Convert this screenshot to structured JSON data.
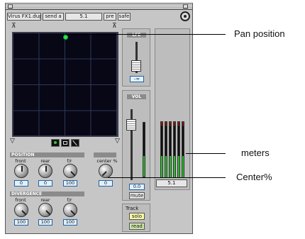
{
  "toolbar": {
    "insert": "Virus FX1.dup1",
    "send": "send a",
    "output": "5.1",
    "pre": "pre",
    "safe": "safe"
  },
  "position": {
    "header": "POSITION",
    "front_label": "front",
    "rear_label": "rear",
    "fr_label": "f/r",
    "center_label": "center %",
    "front_value": "0",
    "rear_value": "0",
    "fr_value": "100",
    "center_value": "0"
  },
  "divergence": {
    "header": "DIVERGENCE",
    "front_label": "front",
    "rear_label": "rear",
    "fr_label": "f/r",
    "front_value": "100",
    "rear_value": "100",
    "fr_value": "100"
  },
  "lfe": {
    "header": "LFE",
    "value": "-∞"
  },
  "vol": {
    "header": "VOL",
    "value": "0.0",
    "mute_label": "mute"
  },
  "meter_section": {
    "output_label": "5.1"
  },
  "track": {
    "label": "Track",
    "solo_label": "solo",
    "read_label": "read"
  },
  "callouts": {
    "pan": "Pan position",
    "meters": "meters",
    "center": "Center%"
  },
  "colors": {
    "grid_bg": "#070716",
    "pan_dot": "#33e633",
    "meter_green": "#27c12b",
    "value_box": "#dff1ff"
  }
}
